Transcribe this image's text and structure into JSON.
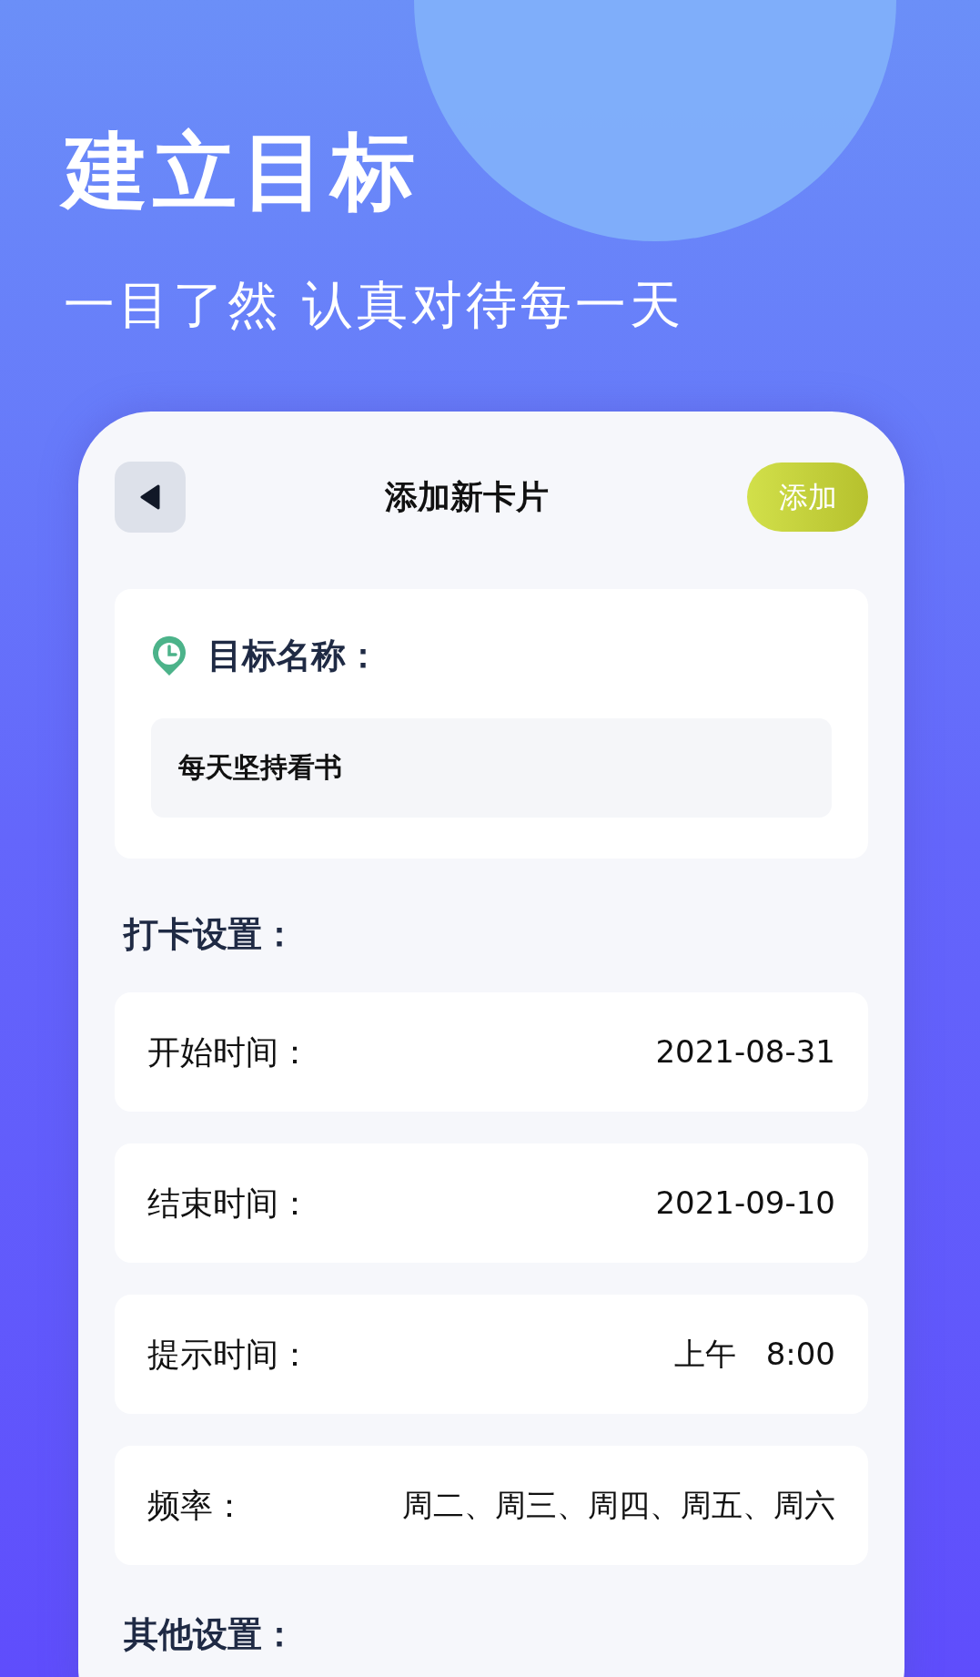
{
  "headline": "建立目标",
  "subtitle": "一目了然 认真对待每一天",
  "screen": {
    "title": "添加新卡片",
    "add_button": "添加",
    "goal": {
      "label": "目标名称：",
      "value": "每天坚持看书"
    },
    "checkin_section": "打卡设置：",
    "settings": [
      {
        "label": "开始时间：",
        "value": "2021-08-31"
      },
      {
        "label": "结束时间：",
        "value": "2021-09-10"
      },
      {
        "label": "提示时间：",
        "value": "上午   8:00"
      },
      {
        "label": "频率：",
        "value": "周二、周三、周四、周五、周六"
      }
    ],
    "other_section": "其他设置："
  }
}
